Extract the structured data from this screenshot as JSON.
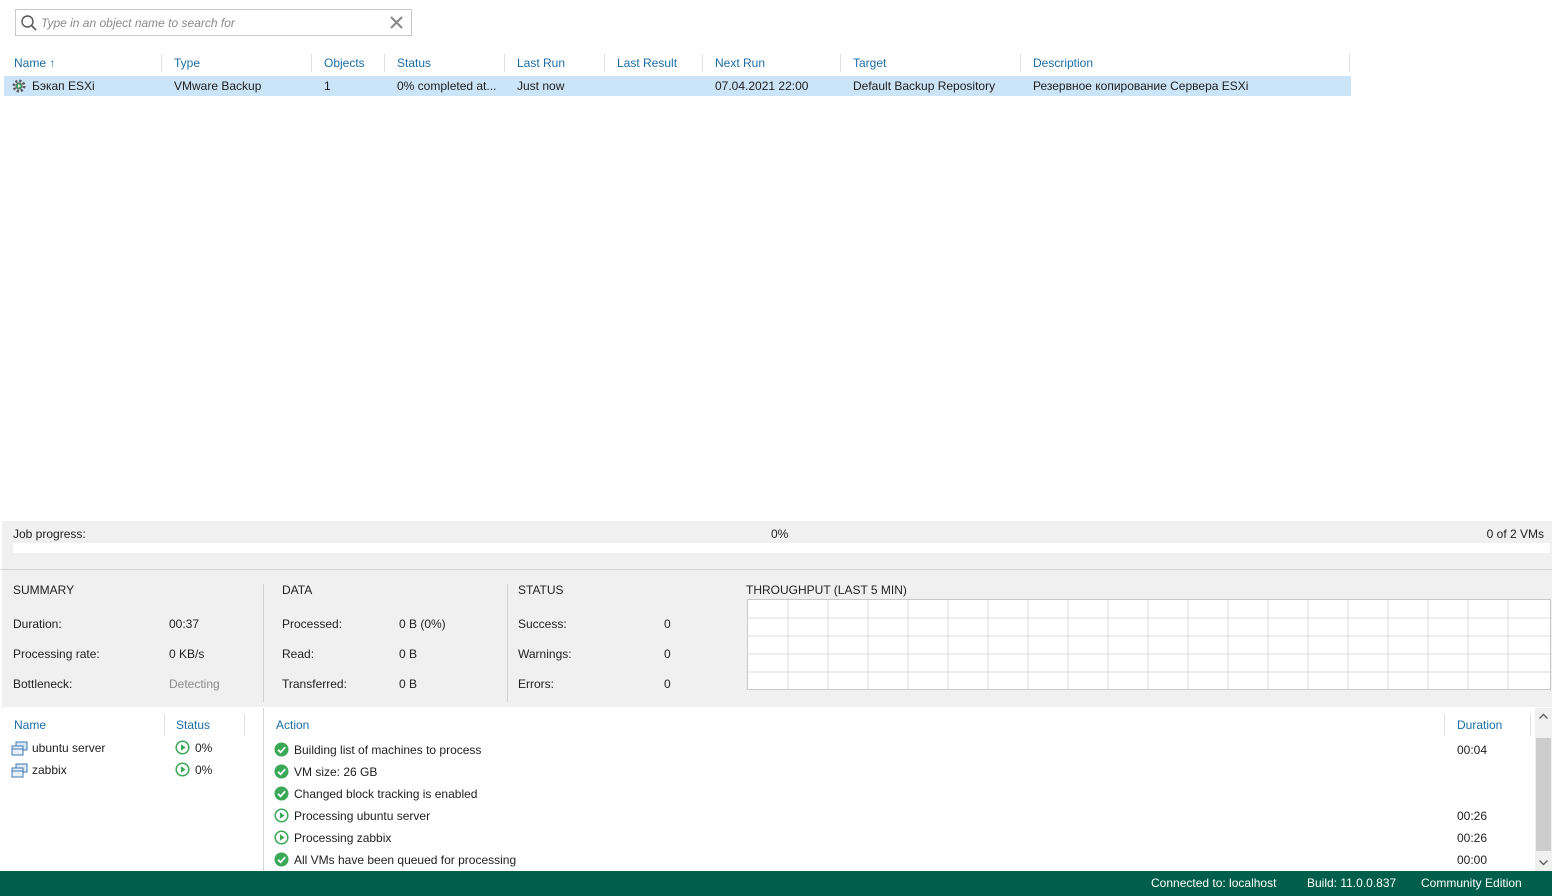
{
  "search": {
    "placeholder": "Type in an object name to search for",
    "value": ""
  },
  "jobs": {
    "columns": [
      "Name",
      "Type",
      "Objects",
      "Status",
      "Last Run",
      "Last Result",
      "Next Run",
      "Target",
      "Description"
    ],
    "sort_indicator": "↑",
    "rows": [
      {
        "name": "Бэкап ESXi",
        "type": "VMware Backup",
        "objects": "1",
        "status": "0% completed at...",
        "last_run": "Just now",
        "last_result": "",
        "next_run": "07.04.2021 22:00",
        "target": "Default Backup Repository",
        "description": "Резервное копирование Сервера ESXi"
      }
    ]
  },
  "progress": {
    "label": "Job progress:",
    "percent_text": "0%",
    "percent_value": 0,
    "vms_text": "0 of 2 VMs",
    "bar_color": "#2f9a5a"
  },
  "summary": {
    "title": "SUMMARY",
    "duration_label": "Duration:",
    "duration": "00:37",
    "rate_label": "Processing rate:",
    "rate": "0 KB/s",
    "bottleneck_label": "Bottleneck:",
    "bottleneck": "Detecting"
  },
  "data_section": {
    "title": "DATA",
    "processed_label": "Processed:",
    "processed": "0 B (0%)",
    "read_label": "Read:",
    "read": "0 B",
    "transferred_label": "Transferred:",
    "transferred": "0 B"
  },
  "status_section": {
    "title": "STATUS",
    "success_label": "Success:",
    "success": "0",
    "warnings_label": "Warnings:",
    "warnings": "0",
    "errors_label": "Errors:",
    "errors": "0"
  },
  "throughput": {
    "title": "THROUGHPUT (LAST 5 MIN)"
  },
  "vm_list": {
    "columns": [
      "Name",
      "Status"
    ],
    "rows": [
      {
        "name": "ubuntu server",
        "status": "0%",
        "status_icon": "running-icon"
      },
      {
        "name": "zabbix",
        "status": "0%",
        "status_icon": "running-icon"
      }
    ]
  },
  "actions": {
    "columns": [
      "Action",
      "Duration"
    ],
    "rows": [
      {
        "text": "Building list of machines to process",
        "duration": "00:04",
        "icon": "success-icon"
      },
      {
        "text": "VM size: 26 GB",
        "duration": "",
        "icon": "success-icon"
      },
      {
        "text": "Changed block tracking is enabled",
        "duration": "",
        "icon": "success-icon"
      },
      {
        "text": "Processing ubuntu server",
        "duration": "00:26",
        "icon": "running-icon"
      },
      {
        "text": "Processing zabbix",
        "duration": "00:26",
        "icon": "running-icon"
      },
      {
        "text": "All VMs have been queued for processing",
        "duration": "00:00",
        "icon": "success-icon"
      }
    ]
  },
  "statusbar": {
    "connected": "Connected to: localhost",
    "build": "Build: 11.0.0.837",
    "edition": "Community Edition"
  },
  "colors": {
    "accent": "#1b6ea8",
    "selection": "#cce4f7",
    "statusbar": "#005f4b",
    "success": "#3aa857"
  }
}
